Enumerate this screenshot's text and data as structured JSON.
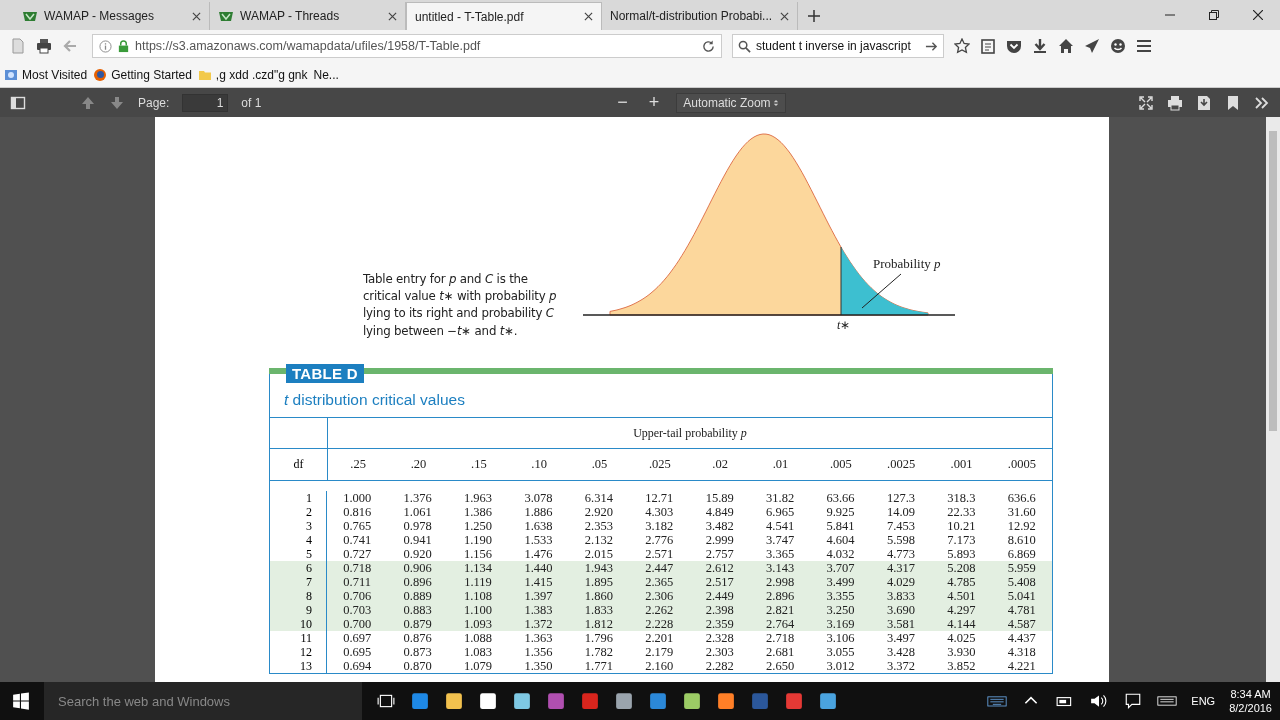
{
  "tabs": [
    {
      "label": "WAMAP - Messages",
      "selected": false
    },
    {
      "label": "WAMAP - Threads",
      "selected": false
    },
    {
      "label": "untitled - T-Table.pdf",
      "selected": true
    },
    {
      "label": "Normal/t-distribution Probabi...",
      "selected": false
    }
  ],
  "address": {
    "url": "https://s3.amazonaws.com/wamapdata/ufiles/1958/T-Table.pdf"
  },
  "search": {
    "value": "student t inverse in javascript"
  },
  "bookmarks": [
    {
      "label": "Most Visited"
    },
    {
      "label": "Getting Started"
    },
    {
      "label": ",g xdd .czd\"g gnk"
    },
    {
      "label": "Ne..."
    }
  ],
  "pdf_toolbar": {
    "page_label": "Page:",
    "page_value": "1",
    "page_count": "of 1",
    "zoom_out": "−",
    "zoom_in": "+",
    "zoom": "Automatic Zoom"
  },
  "figure": {
    "caption": "Table entry for *p* and *C* is the critical value *t*∗ with probability *p* lying to its right and probability *C* lying between −*t*∗ and *t*∗.",
    "area_label": "Probability *p*",
    "axis_label": "*t*∗"
  },
  "table": {
    "badge": "TABLE D",
    "title": "*t* distribution critical values",
    "group_header": "Upper-tail probability *p*",
    "df_header": "df",
    "columns": [
      ".25",
      ".20",
      ".15",
      ".10",
      ".05",
      ".025",
      ".02",
      ".01",
      ".005",
      ".0025",
      ".001",
      ".0005"
    ],
    "rows": [
      {
        "df": "1",
        "shaded": false,
        "values": [
          "1.000",
          "1.376",
          "1.963",
          "3.078",
          "6.314",
          "12.71",
          "15.89",
          "31.82",
          "63.66",
          "127.3",
          "318.3",
          "636.6"
        ]
      },
      {
        "df": "2",
        "shaded": false,
        "values": [
          "0.816",
          "1.061",
          "1.386",
          "1.886",
          "2.920",
          "4.303",
          "4.849",
          "6.965",
          "9.925",
          "14.09",
          "22.33",
          "31.60"
        ]
      },
      {
        "df": "3",
        "shaded": false,
        "values": [
          "0.765",
          "0.978",
          "1.250",
          "1.638",
          "2.353",
          "3.182",
          "3.482",
          "4.541",
          "5.841",
          "7.453",
          "10.21",
          "12.92"
        ]
      },
      {
        "df": "4",
        "shaded": false,
        "values": [
          "0.741",
          "0.941",
          "1.190",
          "1.533",
          "2.132",
          "2.776",
          "2.999",
          "3.747",
          "4.604",
          "5.598",
          "7.173",
          "8.610"
        ]
      },
      {
        "df": "5",
        "shaded": false,
        "values": [
          "0.727",
          "0.920",
          "1.156",
          "1.476",
          "2.015",
          "2.571",
          "2.757",
          "3.365",
          "4.032",
          "4.773",
          "5.893",
          "6.869"
        ]
      },
      {
        "df": "6",
        "shaded": true,
        "values": [
          "0.718",
          "0.906",
          "1.134",
          "1.440",
          "1.943",
          "2.447",
          "2.612",
          "3.143",
          "3.707",
          "4.317",
          "5.208",
          "5.959"
        ]
      },
      {
        "df": "7",
        "shaded": true,
        "values": [
          "0.711",
          "0.896",
          "1.119",
          "1.415",
          "1.895",
          "2.365",
          "2.517",
          "2.998",
          "3.499",
          "4.029",
          "4.785",
          "5.408"
        ]
      },
      {
        "df": "8",
        "shaded": true,
        "values": [
          "0.706",
          "0.889",
          "1.108",
          "1.397",
          "1.860",
          "2.306",
          "2.449",
          "2.896",
          "3.355",
          "3.833",
          "4.501",
          "5.041"
        ]
      },
      {
        "df": "9",
        "shaded": true,
        "values": [
          "0.703",
          "0.883",
          "1.100",
          "1.383",
          "1.833",
          "2.262",
          "2.398",
          "2.821",
          "3.250",
          "3.690",
          "4.297",
          "4.781"
        ]
      },
      {
        "df": "10",
        "shaded": true,
        "values": [
          "0.700",
          "0.879",
          "1.093",
          "1.372",
          "1.812",
          "2.228",
          "2.359",
          "2.764",
          "3.169",
          "3.581",
          "4.144",
          "4.587"
        ]
      },
      {
        "df": "11",
        "shaded": false,
        "values": [
          "0.697",
          "0.876",
          "1.088",
          "1.363",
          "1.796",
          "2.201",
          "2.328",
          "2.718",
          "3.106",
          "3.497",
          "4.025",
          "4.437"
        ]
      },
      {
        "df": "12",
        "shaded": false,
        "values": [
          "0.695",
          "0.873",
          "1.083",
          "1.356",
          "1.782",
          "2.179",
          "2.303",
          "2.681",
          "3.055",
          "3.428",
          "3.930",
          "4.318"
        ]
      },
      {
        "df": "13",
        "shaded": false,
        "values": [
          "0.694",
          "0.870",
          "1.079",
          "1.350",
          "1.771",
          "2.160",
          "2.282",
          "2.650",
          "3.012",
          "3.372",
          "3.852",
          "4.221"
        ]
      }
    ]
  },
  "taskbar": {
    "search_placeholder": "Search the web and Windows",
    "language": "ENG",
    "time": "8:34 AM",
    "date": "8/2/2016"
  }
}
